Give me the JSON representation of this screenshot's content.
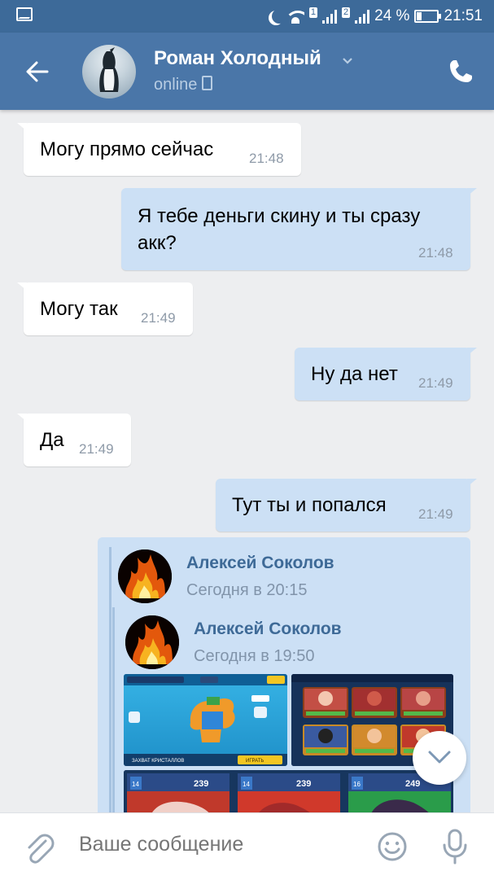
{
  "status_bar": {
    "battery": "24 %",
    "time": "21:51",
    "sim_badge": "1",
    "sim2_badge": "2"
  },
  "header": {
    "name": "Роман Холодный",
    "status": "online"
  },
  "messages": [
    {
      "dir": "in",
      "text": "Могу прямо сейчас",
      "time": "21:48"
    },
    {
      "dir": "out",
      "text_line1": "Я тебе деньги скину и ты сразу",
      "text_line2": "акк?",
      "time": "21:48"
    },
    {
      "dir": "in",
      "text": "Могу так",
      "time": "21:49"
    },
    {
      "dir": "out",
      "text": "Ну да нет",
      "time": "21:49"
    },
    {
      "dir": "in",
      "text": "Да",
      "time": "21:49"
    },
    {
      "dir": "out",
      "text": "Тут ты и попался",
      "time": "21:49"
    }
  ],
  "forwarded": {
    "outer": {
      "name": "Алексей Соколов",
      "date": "Сегодня в 20:15"
    },
    "inner": {
      "name": "Алексей Соколов",
      "date": "Сегодня в 19:50"
    },
    "thumb_texts": [
      "ЗАХВАТ КРИСТАЛЛОВ",
      "ИГРАТЬ",
      "239",
      "239",
      "249"
    ]
  },
  "composer": {
    "placeholder": "Ваше сообщение"
  },
  "colors": {
    "header": "#4a76a8",
    "statusbar": "#3d6a99",
    "incoming": "#ffffff",
    "outgoing": "#cce0f5",
    "background": "#edeef0"
  }
}
